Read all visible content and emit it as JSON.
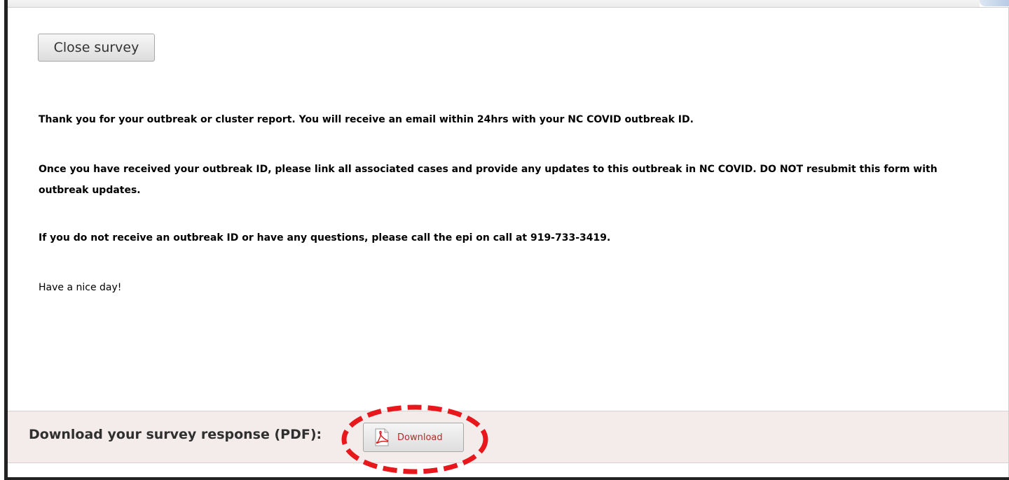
{
  "close_button": {
    "label": "Close survey"
  },
  "messages": {
    "line1": "Thank you for your outbreak or cluster report. You will receive an email within 24hrs with your NC COVID outbreak ID.",
    "line2": "Once you have received your outbreak ID, please link all associated cases and provide any updates to this outbreak in NC COVID. DO NOT resubmit this form with outbreak updates.",
    "line3": "If you do not receive an outbreak ID or have any questions, please call the epi on call at 919-733-3419.",
    "line4": "Have a nice day!"
  },
  "download": {
    "label": "Download your survey response (PDF):",
    "button_label": "Download",
    "icon": "pdf-icon"
  },
  "colors": {
    "highlight": "#e8171c",
    "download_bar": "#f4ebeb",
    "download_text": "#b52a2a"
  }
}
